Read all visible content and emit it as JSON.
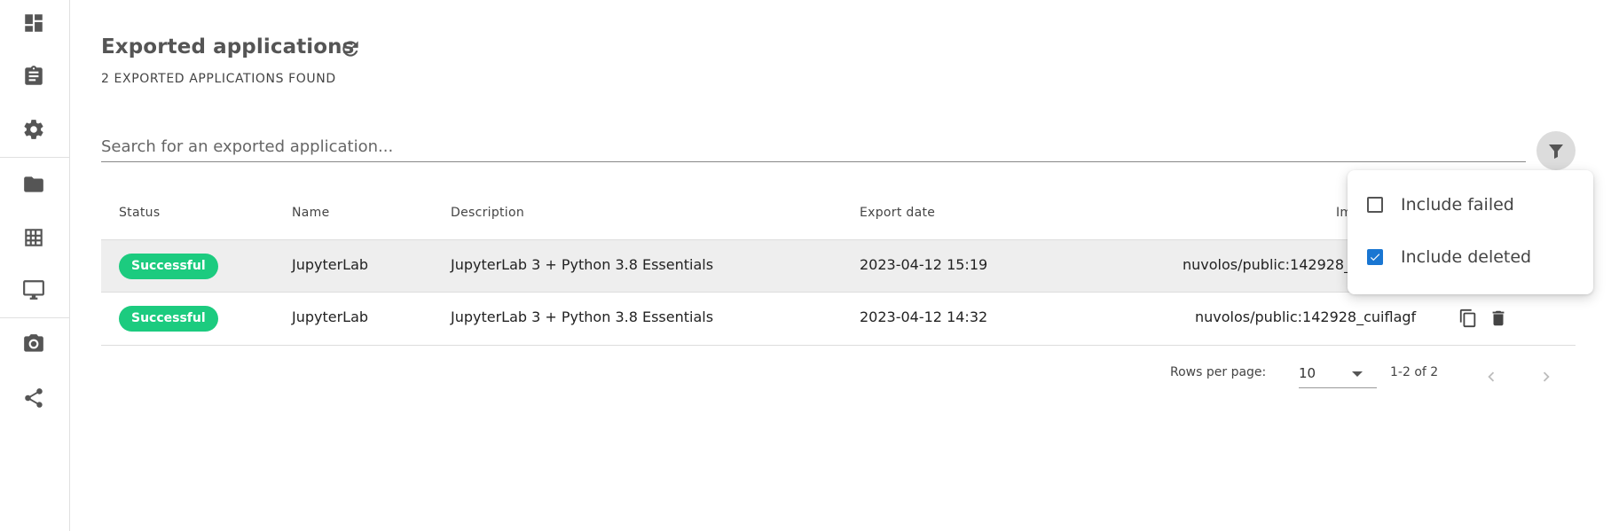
{
  "sidebar": {
    "items": [
      {
        "icon": "dashboard-icon"
      },
      {
        "icon": "clipboard-icon"
      },
      {
        "icon": "gear-icon"
      },
      {
        "icon": "folder-icon"
      },
      {
        "icon": "table-grid-icon"
      },
      {
        "icon": "monitor-icon"
      },
      {
        "icon": "camera-icon"
      },
      {
        "icon": "share-icon"
      }
    ]
  },
  "header": {
    "title": "Exported applications",
    "subtitle": "2 EXPORTED APPLICATIONS FOUND"
  },
  "search": {
    "placeholder": "Search for an exported application..."
  },
  "filter_menu": {
    "options": [
      {
        "label": "Include failed",
        "checked": false
      },
      {
        "label": "Include deleted",
        "checked": true
      }
    ]
  },
  "table": {
    "columns": [
      "Status",
      "Name",
      "Description",
      "Export date",
      "Im"
    ],
    "rows": [
      {
        "status": "Successful",
        "name": "JupyterLab",
        "description": "JupyterLab 3 + Python 3.8 Essentials",
        "export_date": "2023-04-12 15:19",
        "image": "nuvolos/public:142928_"
      },
      {
        "status": "Successful",
        "name": "JupyterLab",
        "description": "JupyterLab 3 + Python 3.8 Essentials",
        "export_date": "2023-04-12 14:32",
        "image": "nuvolos/public:142928_cuiflagf"
      }
    ]
  },
  "pagination": {
    "rows_per_page_label": "Rows per page:",
    "rows_per_page_value": "10",
    "range_text": "1-2 of 2"
  },
  "colors": {
    "success": "#1ccb7f",
    "checkbox_checked": "#1976d2"
  }
}
